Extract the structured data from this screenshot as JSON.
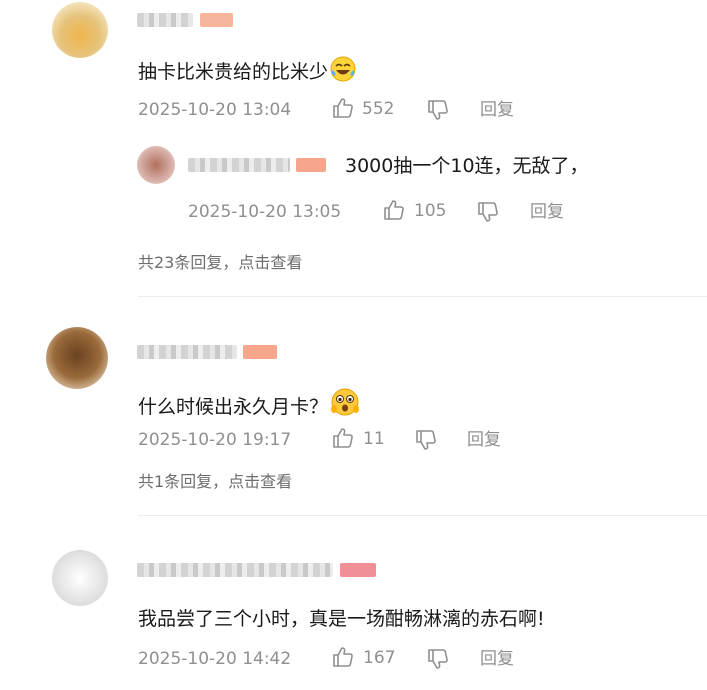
{
  "comments": [
    {
      "text": "抽卡比米贵给的比米少",
      "emoji": "laugh-cry-emoji",
      "time": "2025-10-20 13:04",
      "likes": "552",
      "reply_label": "回复",
      "sub_reply": {
        "text": "3000抽一个10连，无敌了，",
        "time": "2025-10-20 13:05",
        "likes": "105",
        "reply_label": "回复"
      },
      "more_replies": "共23条回复，点击查看"
    },
    {
      "text": "什么时候出永久月卡？",
      "emoji": "shocked-emoji",
      "time": "2025-10-20 19:17",
      "likes": "11",
      "reply_label": "回复",
      "more_replies": "共1条回复，点击查看"
    },
    {
      "text": "我品尝了三个小时，真是一场酣畅淋漓的赤石啊!",
      "time": "2025-10-20 14:42",
      "likes": "167",
      "reply_label": "回复"
    }
  ],
  "colors": {
    "text": "#1a1a1a",
    "meta": "#8f8f8f",
    "badge": "#f6a68c",
    "divider": "#ececec"
  }
}
